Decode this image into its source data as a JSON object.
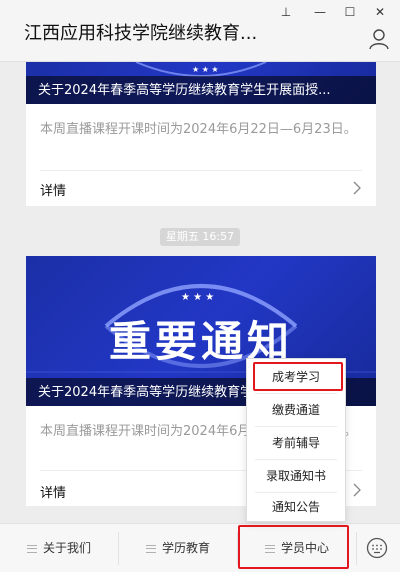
{
  "window": {
    "title": "江西应用科技学院继续教育...",
    "controls": {
      "pin": "⊥",
      "minimize": "—",
      "maximize": "☐",
      "close": "✕"
    }
  },
  "feed": [
    {
      "banner_title": "关于2024年春季高等学历继续教育学生开展面授...",
      "summary": "本周直播课程开课时间为2024年6月22日—6月23日。",
      "details_label": "详情"
    },
    {
      "timestamp": "星期五 16:57",
      "banner_headline": "重要通知",
      "banner_title": "关于2024年春季高等学历继续教育学生开展面授...",
      "summary": "本周直播课程开课时间为2024年6月22日—6月23日。",
      "details_label": "详情"
    }
  ],
  "bottom_menu": {
    "tabs": [
      {
        "label": "关于我们"
      },
      {
        "label": "学历教育"
      },
      {
        "label": "学员中心"
      }
    ],
    "keyboard_icon": "keyboard-icon"
  },
  "popup_menu": {
    "items": [
      "成考学习",
      "缴费通道",
      "考前辅导",
      "录取通知书",
      "通知公告"
    ]
  },
  "colors": {
    "banner_blue": "#1f35bf",
    "highlight_red": "#e3181f"
  }
}
